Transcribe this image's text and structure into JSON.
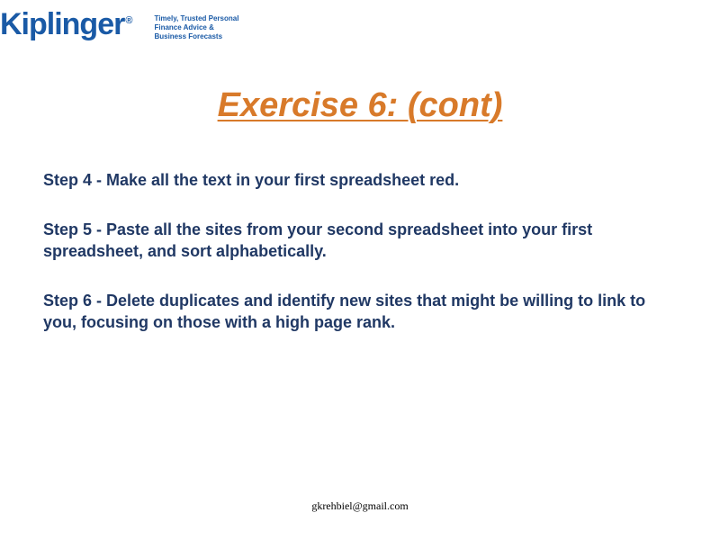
{
  "header": {
    "logo_text": "Kiplinger",
    "logo_reg": "®",
    "tagline": "Timely, Trusted Personal Finance Advice & Business Forecasts"
  },
  "title": "Exercise 6: (cont)",
  "steps": [
    "Step 4 - Make all the text in your first spreadsheet red.",
    "Step 5 - Paste all the sites from your second spreadsheet into your first spreadsheet, and sort alphabetically.",
    "Step 6 - Delete duplicates and identify new sites that might be willing to link to you, focusing on those with a high page rank."
  ],
  "footer": "gkrehbiel@gmail.com"
}
